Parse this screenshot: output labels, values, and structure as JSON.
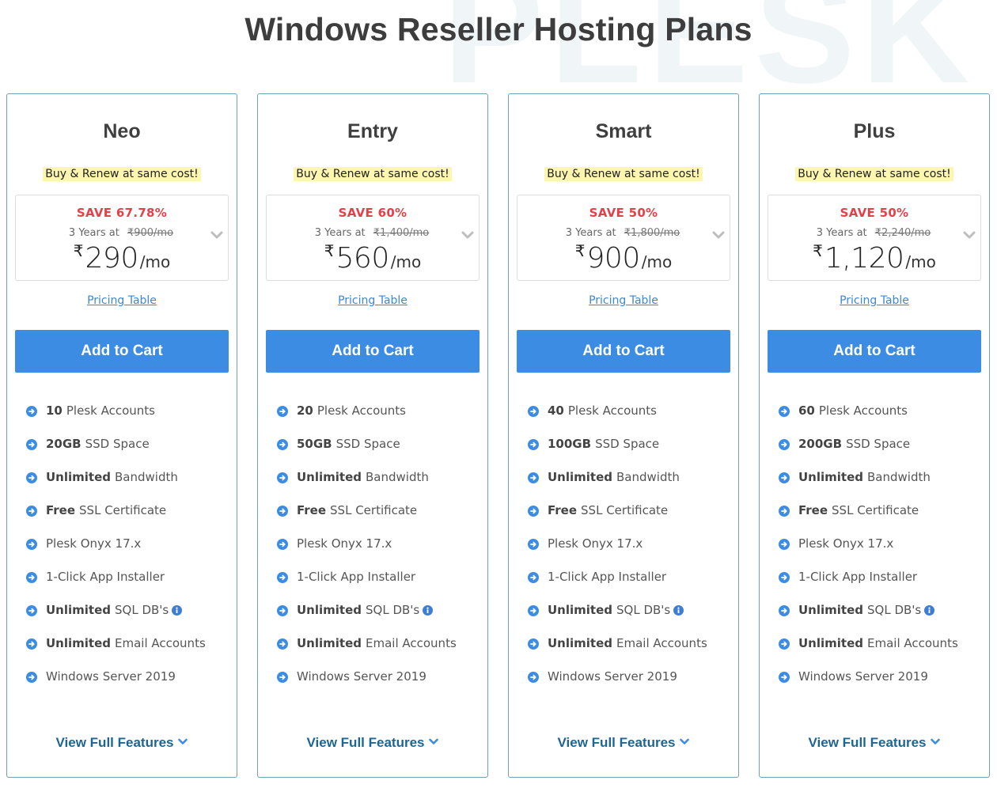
{
  "page": {
    "title": "Windows Reseller Hosting Plans",
    "watermark": "PLESK"
  },
  "colors": {
    "accent_blue": "#3d8ce4",
    "save_red": "#e5404a",
    "highlight_yellow": "#fdf6b0",
    "link_blue": "#3e87d4",
    "view_features_blue": "#1d6691",
    "card_border": "#6f9fb5"
  },
  "plans": [
    {
      "name": "Neo",
      "tagline": "Buy & Renew at same cost!",
      "save": "SAVE 67.78%",
      "term_label": "3 Years at",
      "original_price": "₹900/mo",
      "currency": "₹",
      "price": "290",
      "per": "/mo",
      "pricing_link": "Pricing Table",
      "cta": "Add to Cart",
      "features": [
        {
          "bold": "10",
          "text": "Plesk Accounts",
          "info": false
        },
        {
          "bold": "20GB",
          "text": "SSD Space",
          "info": false
        },
        {
          "bold": "Unlimited",
          "text": "Bandwidth",
          "info": false
        },
        {
          "bold": "Free",
          "text": "SSL Certificate",
          "info": false
        },
        {
          "bold": "",
          "text": "Plesk Onyx 17.x",
          "info": false
        },
        {
          "bold": "",
          "text": "1-Click App Installer",
          "info": false
        },
        {
          "bold": "Unlimited",
          "text": "SQL DB's",
          "info": true
        },
        {
          "bold": "Unlimited",
          "text": "Email Accounts",
          "info": false
        },
        {
          "bold": "",
          "text": "Windows Server 2019",
          "info": false
        }
      ],
      "view_features": "View Full Features"
    },
    {
      "name": "Entry",
      "tagline": "Buy & Renew at same cost!",
      "save": "SAVE 60%",
      "term_label": "3 Years at",
      "original_price": "₹1,400/mo",
      "currency": "₹",
      "price": "560",
      "per": "/mo",
      "pricing_link": "Pricing Table",
      "cta": "Add to Cart",
      "features": [
        {
          "bold": "20",
          "text": "Plesk Accounts",
          "info": false
        },
        {
          "bold": "50GB",
          "text": "SSD Space",
          "info": false
        },
        {
          "bold": "Unlimited",
          "text": "Bandwidth",
          "info": false
        },
        {
          "bold": "Free",
          "text": "SSL Certificate",
          "info": false
        },
        {
          "bold": "",
          "text": "Plesk Onyx 17.x",
          "info": false
        },
        {
          "bold": "",
          "text": "1-Click App Installer",
          "info": false
        },
        {
          "bold": "Unlimited",
          "text": "SQL DB's",
          "info": true
        },
        {
          "bold": "Unlimited",
          "text": "Email Accounts",
          "info": false
        },
        {
          "bold": "",
          "text": "Windows Server 2019",
          "info": false
        }
      ],
      "view_features": "View Full Features"
    },
    {
      "name": "Smart",
      "tagline": "Buy & Renew at same cost!",
      "save": "SAVE 50%",
      "term_label": "3 Years at",
      "original_price": "₹1,800/mo",
      "currency": "₹",
      "price": "900",
      "per": "/mo",
      "pricing_link": "Pricing Table",
      "cta": "Add to Cart",
      "features": [
        {
          "bold": "40",
          "text": "Plesk Accounts",
          "info": false
        },
        {
          "bold": "100GB",
          "text": "SSD Space",
          "info": false
        },
        {
          "bold": "Unlimited",
          "text": "Bandwidth",
          "info": false
        },
        {
          "bold": "Free",
          "text": "SSL Certificate",
          "info": false
        },
        {
          "bold": "",
          "text": "Plesk Onyx 17.x",
          "info": false
        },
        {
          "bold": "",
          "text": "1-Click App Installer",
          "info": false
        },
        {
          "bold": "Unlimited",
          "text": "SQL DB's",
          "info": true
        },
        {
          "bold": "Unlimited",
          "text": "Email Accounts",
          "info": false
        },
        {
          "bold": "",
          "text": "Windows Server 2019",
          "info": false
        }
      ],
      "view_features": "View Full Features"
    },
    {
      "name": "Plus",
      "tagline": "Buy & Renew at same cost!",
      "save": "SAVE 50%",
      "term_label": "3 Years at",
      "original_price": "₹2,240/mo",
      "currency": "₹",
      "price": "1,120",
      "per": "/mo",
      "pricing_link": "Pricing Table",
      "cta": "Add to Cart",
      "features": [
        {
          "bold": "60",
          "text": "Plesk Accounts",
          "info": false
        },
        {
          "bold": "200GB",
          "text": "SSD Space",
          "info": false
        },
        {
          "bold": "Unlimited",
          "text": "Bandwidth",
          "info": false
        },
        {
          "bold": "Free",
          "text": "SSL Certificate",
          "info": false
        },
        {
          "bold": "",
          "text": "Plesk Onyx 17.x",
          "info": false
        },
        {
          "bold": "",
          "text": "1-Click App Installer",
          "info": false
        },
        {
          "bold": "Unlimited",
          "text": "SQL DB's",
          "info": true
        },
        {
          "bold": "Unlimited",
          "text": "Email Accounts",
          "info": false
        },
        {
          "bold": "",
          "text": "Windows Server 2019",
          "info": false
        }
      ],
      "view_features": "View Full Features"
    }
  ]
}
